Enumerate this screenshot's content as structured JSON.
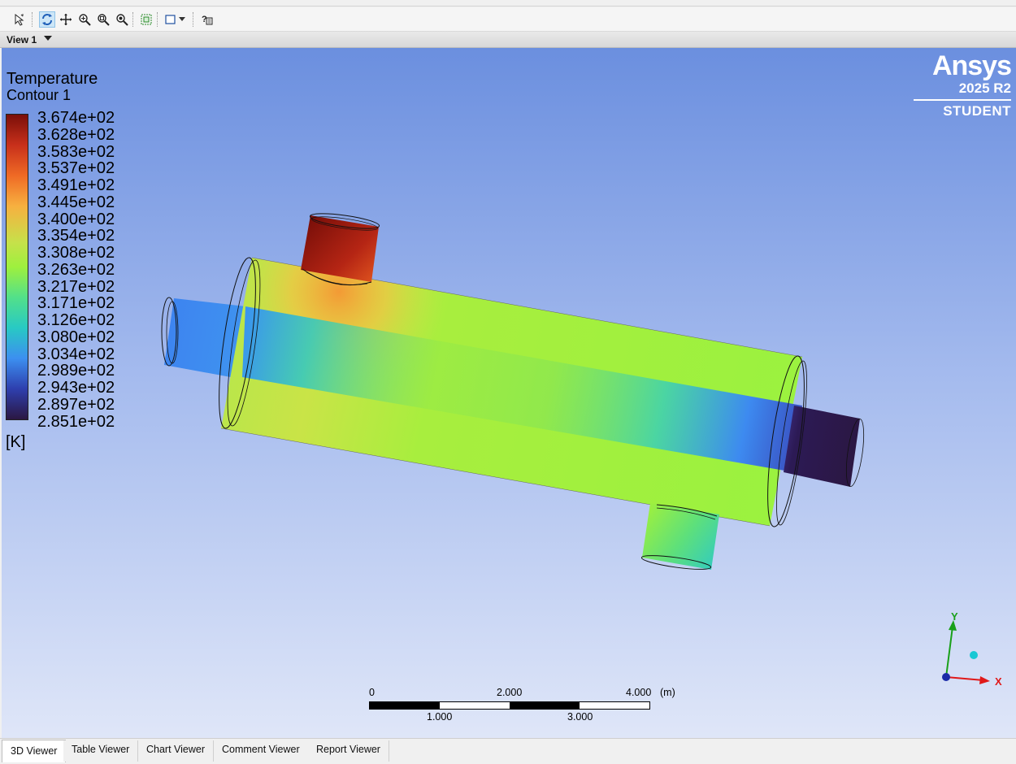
{
  "view": {
    "label": "View 1"
  },
  "legend": {
    "title": "Temperature",
    "subtitle": "Contour 1",
    "values": [
      "3.674e+02",
      "3.628e+02",
      "3.583e+02",
      "3.537e+02",
      "3.491e+02",
      "3.445e+02",
      "3.400e+02",
      "3.354e+02",
      "3.308e+02",
      "3.263e+02",
      "3.217e+02",
      "3.171e+02",
      "3.126e+02",
      "3.080e+02",
      "3.034e+02",
      "2.989e+02",
      "2.943e+02",
      "2.897e+02",
      "2.851e+02"
    ],
    "unit": "[K]"
  },
  "logo": {
    "name": "Ansys",
    "version": "2025 R2",
    "edition": "STUDENT"
  },
  "scale": {
    "top_labels": [
      "0",
      "2.000",
      "4.000"
    ],
    "bottom_labels": [
      "1.000",
      "3.000"
    ],
    "unit": "(m)"
  },
  "axes": {
    "x": "X",
    "y": "Y"
  },
  "tabs": [
    {
      "label": "3D Viewer",
      "active": true
    },
    {
      "label": "Table Viewer",
      "active": false
    },
    {
      "label": "Chart Viewer",
      "active": false
    },
    {
      "label": "Comment Viewer",
      "active": false
    },
    {
      "label": "Report Viewer",
      "active": false
    }
  ],
  "toolbar": {
    "icons": [
      "select-icon",
      "rotate-icon",
      "pan-icon",
      "zoom-icon",
      "zoom-box-icon",
      "fit-view-icon",
      "mesh-icon",
      "viewport-layout-icon",
      "help-icon"
    ]
  },
  "colors": {
    "hot": "#7a0f09",
    "mid": "#9ef03e",
    "cold": "#2b1742",
    "inlet_blue": "#3c8ff0"
  }
}
